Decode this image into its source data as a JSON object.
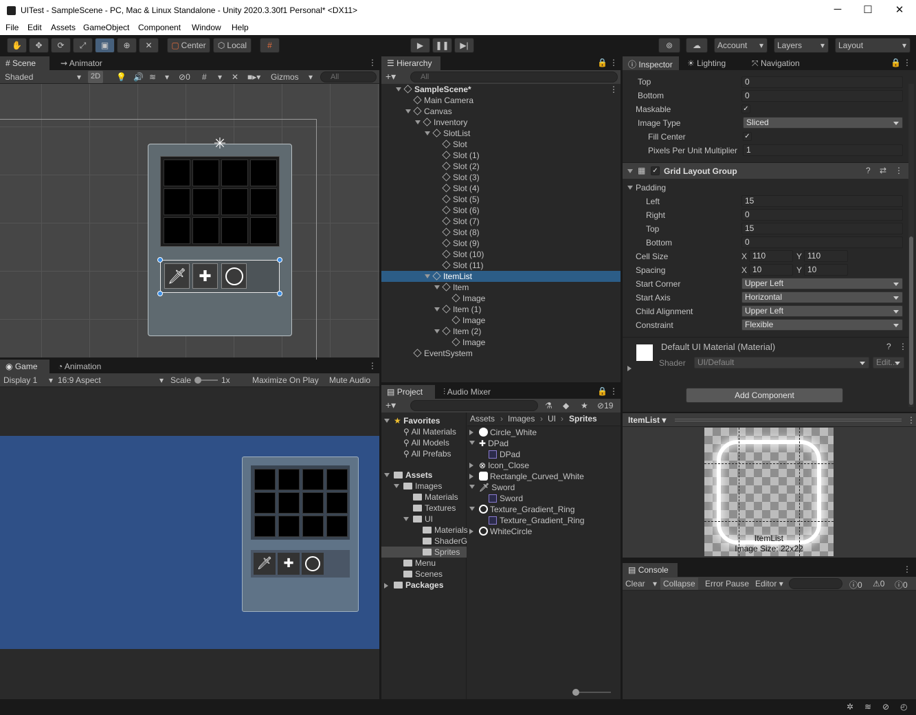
{
  "window": {
    "title": "UITest - SampleScene - PC, Mac & Linux Standalone - Unity 2020.3.30f1 Personal* <DX11>",
    "minimize": "─",
    "maximize": "☐",
    "close": "✕"
  },
  "menu": [
    "File",
    "Edit",
    "Assets",
    "GameObject",
    "Component",
    "Window",
    "Help"
  ],
  "toolbar": {
    "center": "Center",
    "local": "Local",
    "account": "Account",
    "layers": "Layers",
    "layout": "Layout"
  },
  "scene": {
    "tabs": [
      "Scene",
      "Animator"
    ],
    "shading": "Shaded",
    "mode2d": "2D",
    "hidden_count": "0",
    "gizmos": "Gizmos",
    "search_placeholder": "All"
  },
  "game": {
    "tabs": [
      "Game",
      "Animation"
    ],
    "display": "Display 1",
    "aspect": "16:9 Aspect",
    "scale_label": "Scale",
    "scale_value": "1x",
    "maximize": "Maximize On Play",
    "mute": "Mute Audio"
  },
  "hierarchy": {
    "title": "Hierarchy",
    "search_placeholder": "All",
    "items": [
      {
        "label": "SampleScene*",
        "indent": 0
      },
      {
        "label": "Main Camera",
        "indent": 1
      },
      {
        "label": "Canvas",
        "indent": 1
      },
      {
        "label": "Inventory",
        "indent": 2
      },
      {
        "label": "SlotList",
        "indent": 3
      },
      {
        "label": "Slot",
        "indent": 4
      },
      {
        "label": "Slot (1)",
        "indent": 4
      },
      {
        "label": "Slot (2)",
        "indent": 4
      },
      {
        "label": "Slot (3)",
        "indent": 4
      },
      {
        "label": "Slot (4)",
        "indent": 4
      },
      {
        "label": "Slot (5)",
        "indent": 4
      },
      {
        "label": "Slot (6)",
        "indent": 4
      },
      {
        "label": "Slot (7)",
        "indent": 4
      },
      {
        "label": "Slot (8)",
        "indent": 4
      },
      {
        "label": "Slot (9)",
        "indent": 4
      },
      {
        "label": "Slot (10)",
        "indent": 4
      },
      {
        "label": "Slot (11)",
        "indent": 4
      },
      {
        "label": "ItemList",
        "indent": 3,
        "selected": true
      },
      {
        "label": "Item",
        "indent": 4
      },
      {
        "label": "Image",
        "indent": 5
      },
      {
        "label": "Item (1)",
        "indent": 4
      },
      {
        "label": "Image",
        "indent": 5
      },
      {
        "label": "Item (2)",
        "indent": 4
      },
      {
        "label": "Image",
        "indent": 5
      },
      {
        "label": "EventSystem",
        "indent": 1
      }
    ]
  },
  "project": {
    "tabs": [
      "Project",
      "Audio Mixer"
    ],
    "hidden_count": "19",
    "tree": [
      {
        "label": "Favorites",
        "indent": 0,
        "bold": true
      },
      {
        "label": "All Materials",
        "indent": 1
      },
      {
        "label": "All Models",
        "indent": 1
      },
      {
        "label": "All Prefabs",
        "indent": 1
      },
      {
        "label": "Assets",
        "indent": 0,
        "bold": true
      },
      {
        "label": "Images",
        "indent": 1
      },
      {
        "label": "Materials",
        "indent": 2
      },
      {
        "label": "Textures",
        "indent": 2
      },
      {
        "label": "UI",
        "indent": 2
      },
      {
        "label": "Materials",
        "indent": 3
      },
      {
        "label": "ShaderG",
        "indent": 3
      },
      {
        "label": "Sprites",
        "indent": 3
      },
      {
        "label": "Menu",
        "indent": 1
      },
      {
        "label": "Scenes",
        "indent": 1
      },
      {
        "label": "Packages",
        "indent": 0,
        "bold": true
      }
    ],
    "breadcrumb": [
      "Assets",
      "Images",
      "UI",
      "Sprites"
    ],
    "assets": [
      {
        "label": "Circle_White",
        "icon": "circle-icon",
        "sub": false
      },
      {
        "label": "DPad",
        "icon": "dpad-icon",
        "sub": false
      },
      {
        "label": "DPad",
        "icon": "sprite-icon",
        "sub": true
      },
      {
        "label": "Icon_Close",
        "icon": "close-circle-icon",
        "sub": false
      },
      {
        "label": "Rectangle_Curved_White",
        "icon": "rect-icon",
        "sub": false
      },
      {
        "label": "Sword",
        "icon": "sword-icon",
        "sub": false
      },
      {
        "label": "Sword",
        "icon": "sprite-icon",
        "sub": true
      },
      {
        "label": "Texture_Gradient_Ring",
        "icon": "ring-icon",
        "sub": false
      },
      {
        "label": "Texture_Gradient_Ring",
        "icon": "sprite-icon",
        "sub": true
      },
      {
        "label": "WhiteCircle",
        "icon": "ring-icon",
        "sub": false
      }
    ]
  },
  "inspector": {
    "tabs": [
      "Inspector",
      "Lighting",
      "Navigation"
    ],
    "top_rows": [
      {
        "label": "Top",
        "value": "0"
      },
      {
        "label": "Bottom",
        "value": "0"
      }
    ],
    "maskable_label": "Maskable",
    "image_type_label": "Image Type",
    "image_type_value": "Sliced",
    "fill_center_label": "Fill Center",
    "ppu_label": "Pixels Per Unit Multiplier",
    "ppu_value": "1",
    "grid_title": "Grid Layout Group",
    "padding_label": "Padding",
    "padding": [
      {
        "label": "Left",
        "value": "15"
      },
      {
        "label": "Right",
        "value": "0"
      },
      {
        "label": "Top",
        "value": "15"
      },
      {
        "label": "Bottom",
        "value": "0"
      }
    ],
    "cell_size_label": "Cell Size",
    "cell_x": "110",
    "cell_y": "110",
    "spacing_label": "Spacing",
    "spacing_x": "10",
    "spacing_y": "10",
    "dropdowns": [
      {
        "label": "Start Corner",
        "value": "Upper Left"
      },
      {
        "label": "Start Axis",
        "value": "Horizontal"
      },
      {
        "label": "Child Alignment",
        "value": "Upper Left"
      },
      {
        "label": "Constraint",
        "value": "Flexible"
      }
    ],
    "material_title": "Default UI Material (Material)",
    "shader_label": "Shader",
    "shader_value": "UI/Default",
    "edit_label": "Edit...",
    "add_component": "Add Component",
    "preview_title": "ItemList",
    "preview_caption": "ItemList",
    "preview_size": "Image Size: 22x22"
  },
  "console": {
    "title": "Console",
    "clear": "Clear",
    "collapse": "Collapse",
    "error_pause": "Error Pause",
    "editor": "Editor",
    "info_count": "0",
    "warn_count": "0",
    "error_count": "0"
  }
}
